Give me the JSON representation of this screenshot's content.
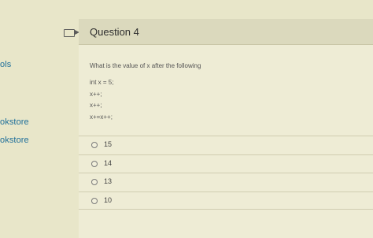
{
  "sidebar": {
    "items": [
      {
        "label": "ols"
      },
      {
        "label": "okstore"
      },
      {
        "label": "okstore"
      }
    ]
  },
  "question": {
    "title": "Question 4",
    "prompt": "What is the value of x after the following",
    "code": [
      "int x = 5;",
      "x++;",
      "x++;",
      "x+=x++;"
    ],
    "options": [
      "15",
      "14",
      "13",
      "10"
    ]
  }
}
